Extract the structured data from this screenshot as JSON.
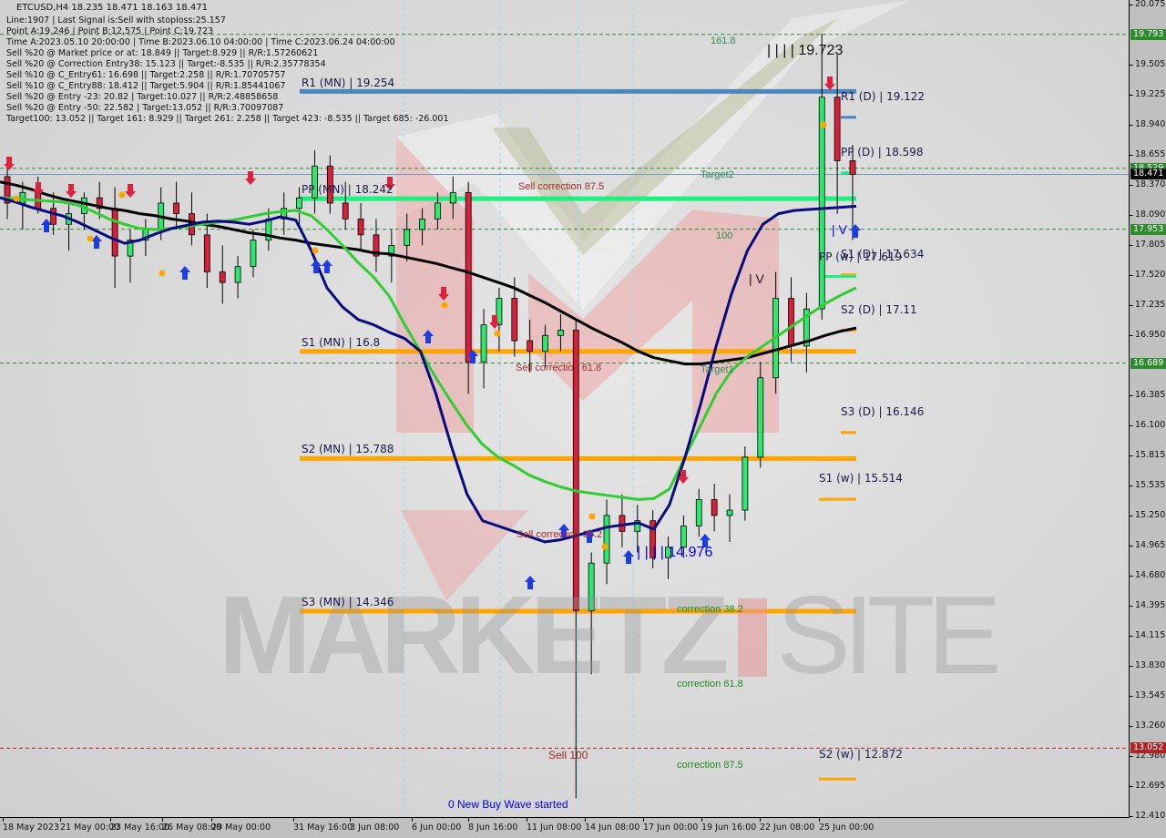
{
  "header": {
    "title": "ETCUSD,H4  18.235 18.471 18.163 18.471",
    "lines": [
      "Line:1907 | Last Signal is:Sell with stoploss:25.157",
      "Point A:19.246 | Point B:12.575 | Point C:19.723",
      "Time A:2023.05.10 20:00:00 | Time B:2023.06.10 04:00:00 | Time C:2023.06.24 04:00:00",
      "Sell %20 @ Market price or at: 18.849 || Target:8.929 || R/R:1.57260621",
      "Sell %20 @ Correction Entry38: 15.123 || Target:-8.535 || R/R:2.35778354",
      "Sell %10 @ C_Entry61: 16.698 || Target:2.258 || R/R:1.70705757",
      "Sell %10 @ C_Entry88: 18.412 || Target:5.904 || R/R:1.85441067",
      "Sell %20 @ Entry -23: 20.82 | Target:10.027 || R/R:2.48858658",
      "Sell %20 @ Entry -50: 22.582 | Target:13.052 || R/R:3.70097087",
      "Target100: 13.052 || Target 161: 8.929 || Target 261: 2.258 || Target 423: -8.535 || Target 685: -26.001"
    ]
  },
  "chart_data": {
    "type": "candlestick",
    "symbol": "ETCUSD",
    "timeframe": "H4",
    "ohlc_last": {
      "open": 18.235,
      "high": 18.471,
      "low": 18.163,
      "close": 18.471
    },
    "ylim": [
      12.41,
      20.075
    ],
    "y_ticks": [
      "20.075",
      "19.505",
      "19.225",
      "18.940",
      "18.655",
      "18.370",
      "18.090",
      "17.805",
      "17.520",
      "17.235",
      "16.950",
      "16.385",
      "16.100",
      "15.815",
      "15.535",
      "15.250",
      "14.965",
      "14.680",
      "14.395",
      "14.115",
      "13.830",
      "13.545",
      "13.260",
      "12.980",
      "12.695",
      "12.410"
    ],
    "x_ticks": [
      "18 May 2023",
      "21 May 00:00",
      "23 May 16:00",
      "26 May 08:00",
      "29 May 00:00",
      "31 May 16:00",
      "3 Jun 08:00",
      "6 Jun 00:00",
      "8 Jun 16:00",
      "11 Jun 08:00",
      "14 Jun 08:00",
      "17 Jun 00:00",
      "19 Jun 16:00",
      "22 Jun 08:00",
      "25 Jun 00:00"
    ],
    "price_badges": [
      {
        "value": "19.793",
        "color": "#2e8b2e"
      },
      {
        "value": "18.529",
        "color": "#2e8b2e"
      },
      {
        "value": "18.471",
        "color": "#000000"
      },
      {
        "value": "17.953",
        "color": "#2e8b2e"
      },
      {
        "value": "16.689",
        "color": "#2e8b2e"
      },
      {
        "value": "13.052",
        "color": "#b22222"
      }
    ],
    "dashed_levels": [
      {
        "value": 19.793,
        "color": "#2e8b2e"
      },
      {
        "value": 18.529,
        "color": "#2e8b2e"
      },
      {
        "value": 17.953,
        "color": "#2e8b2e"
      },
      {
        "value": 16.689,
        "color": "#2e8b2e"
      },
      {
        "value": 13.052,
        "color": "#b22222"
      }
    ],
    "pivot_levels": [
      {
        "label": "R1 (MN) | 19.254",
        "value": 19.254,
        "color": "#4a86c0",
        "x0": 0.26,
        "x1": 0.755
      },
      {
        "label": "PP (MN) | 18.242",
        "value": 18.242,
        "color": "#1ef080",
        "x0": 0.26,
        "x1": 0.755
      },
      {
        "label": "S1 (MN) | 16.8",
        "value": 16.8,
        "color": "#ffa500",
        "x0": 0.26,
        "x1": 0.755
      },
      {
        "label": "S2 (MN) | 15.788",
        "value": 15.788,
        "color": "#ffa500",
        "x0": 0.26,
        "x1": 0.755
      },
      {
        "label": "S3 (MN) | 14.346",
        "value": 14.346,
        "color": "#ffa500",
        "x0": 0.26,
        "x1": 0.755
      }
    ],
    "short_levels": [
      {
        "label": "R1 (D) | 19.122",
        "value": 19.122,
        "color": "#4a86c0"
      },
      {
        "label": "PP (D) | 18.598",
        "value": 18.598,
        "color": "#1ef080"
      },
      {
        "label": "S1 (D) | 17.634",
        "value": 17.634,
        "color": "#ffa500"
      },
      {
        "label": "PP (w) | 17.619",
        "value": 17.619,
        "color": "#1ef080"
      },
      {
        "label": "S2 (D) | 17.11",
        "value": 17.11,
        "color": "#ffa500"
      },
      {
        "label": "S3 (D) | 16.146",
        "value": 16.146,
        "color": "#ffa500"
      },
      {
        "label": "S1 (w) | 15.514",
        "value": 15.514,
        "color": "#ffa500"
      },
      {
        "label": "S2 (w) | 12.872",
        "value": 12.872,
        "color": "#ffa500"
      }
    ],
    "annotations": [
      {
        "text": "161.8",
        "color": "#2e8b57"
      },
      {
        "text": "| | | | 19.723",
        "color": "#111111"
      },
      {
        "text": "Target2",
        "color": "#2e8b57"
      },
      {
        "text": "100",
        "color": "#2e8b57"
      },
      {
        "text": "Sell correction 87.5",
        "color": "#a52a2a"
      },
      {
        "text": "Sell correction 61.8",
        "color": "#a52a2a"
      },
      {
        "text": "Sell correction 38.2",
        "color": "#a52a2a"
      },
      {
        "text": "Target1",
        "color": "#2e8b57"
      },
      {
        "text": "| | | | 14.976",
        "color": "#0000ee"
      },
      {
        "text": "correction 38.2",
        "color": "#228b22"
      },
      {
        "text": "correction 61.8",
        "color": "#228b22"
      },
      {
        "text": "correction 87.5",
        "color": "#228b22"
      },
      {
        "text": "Sell 100",
        "color": "#a52a2a"
      },
      {
        "text": "0 New Buy Wave started",
        "color": "#0000ee"
      },
      {
        "text": "| V",
        "color": "#111111"
      },
      {
        "text": "| V",
        "color": "#0000ee"
      }
    ],
    "ma_series": [
      {
        "name": "MA slow",
        "color": "#000000",
        "values": [
          18.4,
          18.37,
          18.33,
          18.28,
          18.24,
          18.21,
          18.18,
          18.15,
          18.13,
          18.1,
          18.08,
          18.05,
          18.03,
          18.0,
          17.98,
          17.95,
          17.92,
          17.9,
          17.87,
          17.85,
          17.82,
          17.8,
          17.78,
          17.76,
          17.73,
          17.72,
          17.69,
          17.66,
          17.63,
          17.59,
          17.55,
          17.5,
          17.45,
          17.4,
          17.33,
          17.26,
          17.18,
          17.1,
          17.02,
          16.95,
          16.88,
          16.8,
          16.74,
          16.71,
          16.68,
          16.68,
          16.7,
          16.72,
          16.74,
          16.78,
          16.82,
          16.86,
          16.9,
          16.95,
          16.99,
          17.02
        ]
      },
      {
        "name": "MA mid",
        "color": "#32cd32",
        "values": [
          18.25,
          18.24,
          18.23,
          18.22,
          18.21,
          18.18,
          18.12,
          18.05,
          18.0,
          17.96,
          17.95,
          17.96,
          17.98,
          18.0,
          18.02,
          18.04,
          18.07,
          18.1,
          18.12,
          18.13,
          18.08,
          17.95,
          17.8,
          17.64,
          17.5,
          17.32,
          17.05,
          16.8,
          16.55,
          16.32,
          16.1,
          15.92,
          15.8,
          15.72,
          15.63,
          15.57,
          15.52,
          15.48,
          15.46,
          15.44,
          15.42,
          15.4,
          15.41,
          15.5,
          15.8,
          16.1,
          16.4,
          16.62,
          16.75,
          16.85,
          16.95,
          17.05,
          17.15,
          17.25,
          17.33,
          17.4
        ]
      },
      {
        "name": "MA fast",
        "color": "#0a0a80",
        "values": [
          18.25,
          18.21,
          18.16,
          18.12,
          18.08,
          18.02,
          17.95,
          17.88,
          17.82,
          17.85,
          17.91,
          17.96,
          17.99,
          18.02,
          18.03,
          18.02,
          18.0,
          18.03,
          18.07,
          18.04,
          17.75,
          17.4,
          17.22,
          17.1,
          17.05,
          16.98,
          16.92,
          16.8,
          16.4,
          15.9,
          15.45,
          15.2,
          15.15,
          15.1,
          15.05,
          15.0,
          15.02,
          15.06,
          15.1,
          15.14,
          15.16,
          15.18,
          15.12,
          15.35,
          15.8,
          16.3,
          16.85,
          17.35,
          17.75,
          18.0,
          18.1,
          18.13,
          18.14,
          18.15,
          18.16,
          18.17
        ]
      }
    ],
    "candles": [
      [
        18.45,
        18.55,
        18.05,
        18.2
      ],
      [
        18.2,
        18.4,
        17.95,
        18.3
      ],
      [
        18.3,
        18.45,
        18.1,
        18.15
      ],
      [
        18.15,
        18.3,
        17.9,
        18.0
      ],
      [
        18.0,
        18.2,
        17.75,
        18.1
      ],
      [
        18.1,
        18.3,
        17.95,
        18.25
      ],
      [
        18.25,
        18.4,
        18.05,
        18.15
      ],
      [
        18.15,
        18.35,
        17.4,
        17.7
      ],
      [
        17.7,
        17.95,
        17.45,
        17.85
      ],
      [
        17.85,
        18.05,
        17.7,
        17.95
      ],
      [
        17.95,
        18.35,
        17.85,
        18.2
      ],
      [
        18.2,
        18.4,
        17.95,
        18.1
      ],
      [
        18.1,
        18.3,
        17.8,
        17.9
      ],
      [
        17.9,
        18.1,
        17.4,
        17.55
      ],
      [
        17.55,
        17.8,
        17.25,
        17.45
      ],
      [
        17.45,
        17.7,
        17.3,
        17.6
      ],
      [
        17.6,
        17.95,
        17.5,
        17.85
      ],
      [
        17.85,
        18.15,
        17.75,
        18.05
      ],
      [
        18.05,
        18.3,
        17.9,
        18.15
      ],
      [
        18.15,
        18.35,
        17.95,
        18.25
      ],
      [
        18.25,
        18.7,
        18.1,
        18.55
      ],
      [
        18.55,
        18.65,
        18.1,
        18.2
      ],
      [
        18.2,
        18.4,
        17.95,
        18.05
      ],
      [
        18.05,
        18.2,
        17.75,
        17.9
      ],
      [
        17.9,
        18.05,
        17.55,
        17.7
      ],
      [
        17.7,
        17.95,
        17.45,
        17.8
      ],
      [
        17.8,
        18.1,
        17.65,
        17.95
      ],
      [
        17.95,
        18.15,
        17.8,
        18.05
      ],
      [
        18.05,
        18.3,
        17.95,
        18.2
      ],
      [
        18.2,
        18.45,
        18.05,
        18.3
      ],
      [
        18.3,
        18.4,
        16.4,
        16.7
      ],
      [
        16.7,
        17.2,
        16.45,
        17.05
      ],
      [
        17.05,
        17.4,
        16.8,
        17.3
      ],
      [
        17.3,
        17.5,
        16.75,
        16.9
      ],
      [
        16.9,
        17.1,
        16.6,
        16.8
      ],
      [
        16.8,
        17.05,
        16.65,
        16.95
      ],
      [
        16.95,
        17.15,
        16.8,
        17.0
      ],
      [
        17.0,
        17.1,
        12.58,
        14.35
      ],
      [
        14.35,
        14.9,
        13.75,
        14.8
      ],
      [
        14.8,
        15.4,
        14.6,
        15.25
      ],
      [
        15.25,
        15.45,
        14.95,
        15.1
      ],
      [
        15.1,
        15.35,
        14.9,
        15.2
      ],
      [
        15.2,
        15.3,
        14.75,
        14.85
      ],
      [
        14.85,
        15.05,
        14.65,
        14.95
      ],
      [
        14.95,
        15.25,
        14.85,
        15.15
      ],
      [
        15.15,
        15.5,
        15.05,
        15.4
      ],
      [
        15.4,
        15.55,
        15.1,
        15.25
      ],
      [
        15.25,
        15.45,
        15.0,
        15.3
      ],
      [
        15.3,
        15.9,
        15.2,
        15.8
      ],
      [
        15.8,
        16.7,
        15.7,
        16.55
      ],
      [
        16.55,
        17.55,
        16.4,
        17.3
      ],
      [
        17.3,
        17.5,
        16.7,
        16.85
      ],
      [
        16.85,
        17.35,
        16.6,
        17.2
      ],
      [
        17.2,
        19.8,
        17.1,
        19.2
      ],
      [
        19.2,
        19.6,
        18.1,
        18.6
      ],
      [
        18.6,
        18.75,
        17.85,
        18.47
      ]
    ]
  },
  "watermark": {
    "left": "MARKETZ",
    "right": "SITE"
  }
}
